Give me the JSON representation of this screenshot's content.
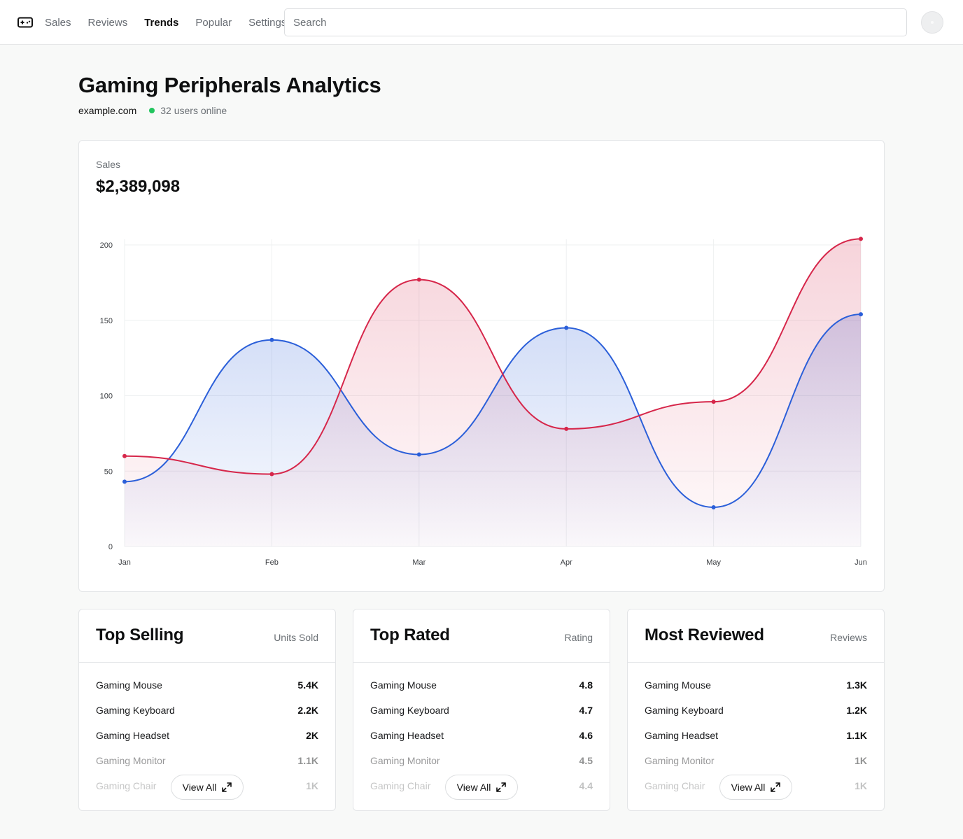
{
  "nav": {
    "logo_icon": "gamepad-icon",
    "items": [
      "Sales",
      "Reviews",
      "Trends",
      "Popular",
      "Settings"
    ],
    "active": "Trends"
  },
  "search": {
    "placeholder": "Search",
    "value": ""
  },
  "page": {
    "title": "Gaming Peripherals Analytics",
    "site": "example.com",
    "online": "32 users online"
  },
  "sales": {
    "label": "Sales",
    "value": "$2,389,098"
  },
  "colors": {
    "series_a": "#2b5fd9",
    "series_b": "#d6264a",
    "online": "#22c55e"
  },
  "chart_data": {
    "type": "area",
    "categories": [
      "Jan",
      "Feb",
      "Mar",
      "Apr",
      "May",
      "Jun"
    ],
    "series": [
      {
        "values": [
          43,
          137,
          61,
          145,
          26,
          154
        ]
      },
      {
        "values": [
          60,
          48,
          177,
          78,
          96,
          204
        ]
      }
    ],
    "ylim": [
      0,
      200
    ],
    "yticks": [
      0,
      50,
      100,
      150,
      200
    ],
    "grid": true
  },
  "lists": [
    {
      "title": "Top Selling",
      "metric": "Units Sold",
      "rows": [
        {
          "name": "Gaming Mouse",
          "value": "5.4K"
        },
        {
          "name": "Gaming Keyboard",
          "value": "2.2K"
        },
        {
          "name": "Gaming Headset",
          "value": "2K"
        },
        {
          "name": "Gaming Monitor",
          "value": "1.1K"
        },
        {
          "name": "Gaming Chair",
          "value": "1K"
        }
      ],
      "view_all": "View All"
    },
    {
      "title": "Top Rated",
      "metric": "Rating",
      "rows": [
        {
          "name": "Gaming Mouse",
          "value": "4.8"
        },
        {
          "name": "Gaming Keyboard",
          "value": "4.7"
        },
        {
          "name": "Gaming Headset",
          "value": "4.6"
        },
        {
          "name": "Gaming Monitor",
          "value": "4.5"
        },
        {
          "name": "Gaming Chair",
          "value": "4.4"
        }
      ],
      "view_all": "View All"
    },
    {
      "title": "Most Reviewed",
      "metric": "Reviews",
      "rows": [
        {
          "name": "Gaming Mouse",
          "value": "1.3K"
        },
        {
          "name": "Gaming Keyboard",
          "value": "1.2K"
        },
        {
          "name": "Gaming Headset",
          "value": "1.1K"
        },
        {
          "name": "Gaming Monitor",
          "value": "1K"
        },
        {
          "name": "Gaming Chair",
          "value": "1K"
        }
      ],
      "view_all": "View All"
    }
  ]
}
